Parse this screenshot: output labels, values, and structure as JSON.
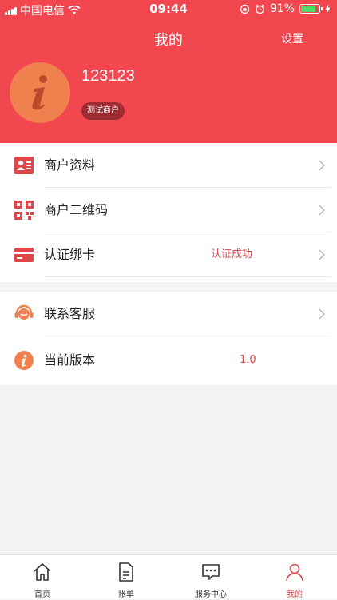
{
  "status_bar": {
    "carrier": "中国电信",
    "time": "09:44",
    "battery": "91%",
    "battery_level": 0.91
  },
  "header": {
    "title": "我的",
    "settings_label": "设置",
    "username": "123123",
    "badge": "测试商户",
    "avatar_icon": "info-icon"
  },
  "menu_main": {
    "items": [
      {
        "label": "商户资料",
        "icon": "merchant-profile-icon"
      },
      {
        "label": "商户二维码",
        "icon": "qr-code-icon"
      },
      {
        "label": "认证绑卡",
        "value": "认证成功",
        "icon": "bank-card-icon"
      }
    ]
  },
  "menu_support": {
    "items": [
      {
        "label": "联系客服",
        "icon": "customer-service-icon"
      },
      {
        "label": "当前版本",
        "value": "1.0",
        "icon": "info-icon"
      }
    ]
  },
  "tabbar": {
    "tabs": [
      {
        "label": "首页",
        "icon": "home-icon"
      },
      {
        "label": "账单",
        "icon": "bill-icon"
      },
      {
        "label": "服务中心",
        "icon": "chat-icon"
      },
      {
        "label": "我的",
        "icon": "person-icon",
        "active": true
      }
    ]
  },
  "colors": {
    "brand": "#f2474f",
    "avatar": "#f0814f",
    "accent_text": "#d84648"
  }
}
